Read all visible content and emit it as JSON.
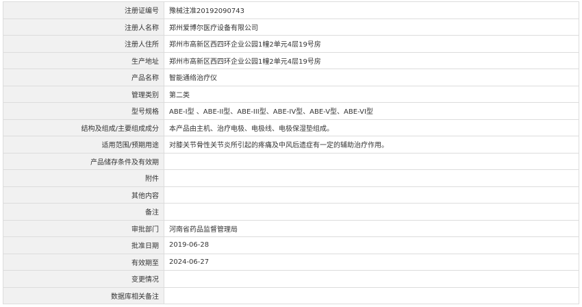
{
  "rows": [
    {
      "label": "注册证编号",
      "value": "豫械注准20192090743"
    },
    {
      "label": "注册人名称",
      "value": "郑州爱博尔医疗设备有限公司"
    },
    {
      "label": "注册人住所",
      "value": "郑州市高新区西四环企业公园1幢2单元4层19号房"
    },
    {
      "label": "生产地址",
      "value": "郑州市高新区西四环企业公园1幢2单元4层19号房"
    },
    {
      "label": "产品名称",
      "value": "智能通络治疗仪"
    },
    {
      "label": "管理类别",
      "value": "第二类"
    },
    {
      "label": "型号规格",
      "value": "ABE-I型 、ABE-II型、ABE-III型、ABE-IV型、ABE-V型、ABE-VI型"
    },
    {
      "label": "结构及组成/主要组成成分",
      "value": "本产品由主机、治疗电极、电极线、电极保湿垫组成。"
    },
    {
      "label": "适用范围/预期用途",
      "value": "对膝关节骨性关节炎所引起的疼痛及中风后遗症有一定的辅助治疗作用。"
    },
    {
      "label": "产品储存条件及有效期",
      "value": ""
    },
    {
      "label": "附件",
      "value": ""
    },
    {
      "label": "其他内容",
      "value": ""
    },
    {
      "label": "备注",
      "value": ""
    },
    {
      "label": "审批部门",
      "value": "河南省药品监督管理局"
    },
    {
      "label": "批准日期",
      "value": "2019-06-28"
    },
    {
      "label": "有效期至",
      "value": "2024-06-27"
    },
    {
      "label": "变更情况",
      "value": ""
    },
    {
      "label": "数据库相关备注",
      "value": ""
    }
  ]
}
